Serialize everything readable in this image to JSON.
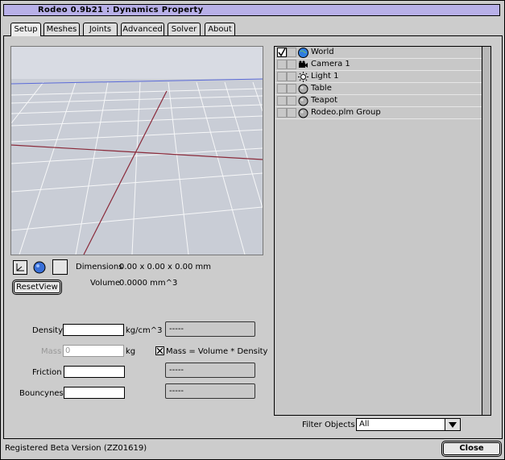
{
  "window": {
    "title": "Rodeo 0.9b21 :  Dynamics Property"
  },
  "tabs": [
    {
      "label": "Setup",
      "active": true
    },
    {
      "label": "Meshes"
    },
    {
      "label": "Joints"
    },
    {
      "label": "Advanced"
    },
    {
      "label": "Solver"
    },
    {
      "label": "About"
    }
  ],
  "viewport": {
    "dimensions_label": "Dimensions",
    "dimensions_value": "0.00 x 0.00 x 0.00 mm",
    "volume_label": "Volume",
    "volume_value": "0.0000 mm^3",
    "reset_button": "ResetView"
  },
  "properties": {
    "density": {
      "label": "Density",
      "value": "",
      "unit": "kg/cm^3",
      "button": "-----"
    },
    "mass": {
      "label": "Mass",
      "placeholder": "0",
      "unit": "kg",
      "checkbox_label": "Mass = Volume * Density",
      "checked": true
    },
    "friction": {
      "label": "Friction",
      "value": "",
      "button": "-----"
    },
    "bouncyness": {
      "label": "Bouncyness",
      "value": "",
      "button": "-----"
    }
  },
  "objects": [
    {
      "name": "World",
      "icon": "globe-icon",
      "checked": true
    },
    {
      "name": "Camera 1",
      "icon": "camera-icon"
    },
    {
      "name": "Light 1",
      "icon": "light-icon"
    },
    {
      "name": "Table",
      "icon": "sphere-icon"
    },
    {
      "name": "Teapot",
      "icon": "sphere-icon"
    },
    {
      "name": "Rodeo.plm Group",
      "icon": "sphere-icon"
    }
  ],
  "filter": {
    "label": "Filter Objects",
    "value": "All"
  },
  "status": {
    "text": "Registered Beta Version (ZZ01619)"
  },
  "close_button": "Close",
  "colors": {
    "titlebar": "#b8b0e8",
    "viewport_bg": "#c9cdd6",
    "grid": "#ffffff",
    "axis_x": "#8a2a3a",
    "axis_z": "#5a6ad8"
  }
}
